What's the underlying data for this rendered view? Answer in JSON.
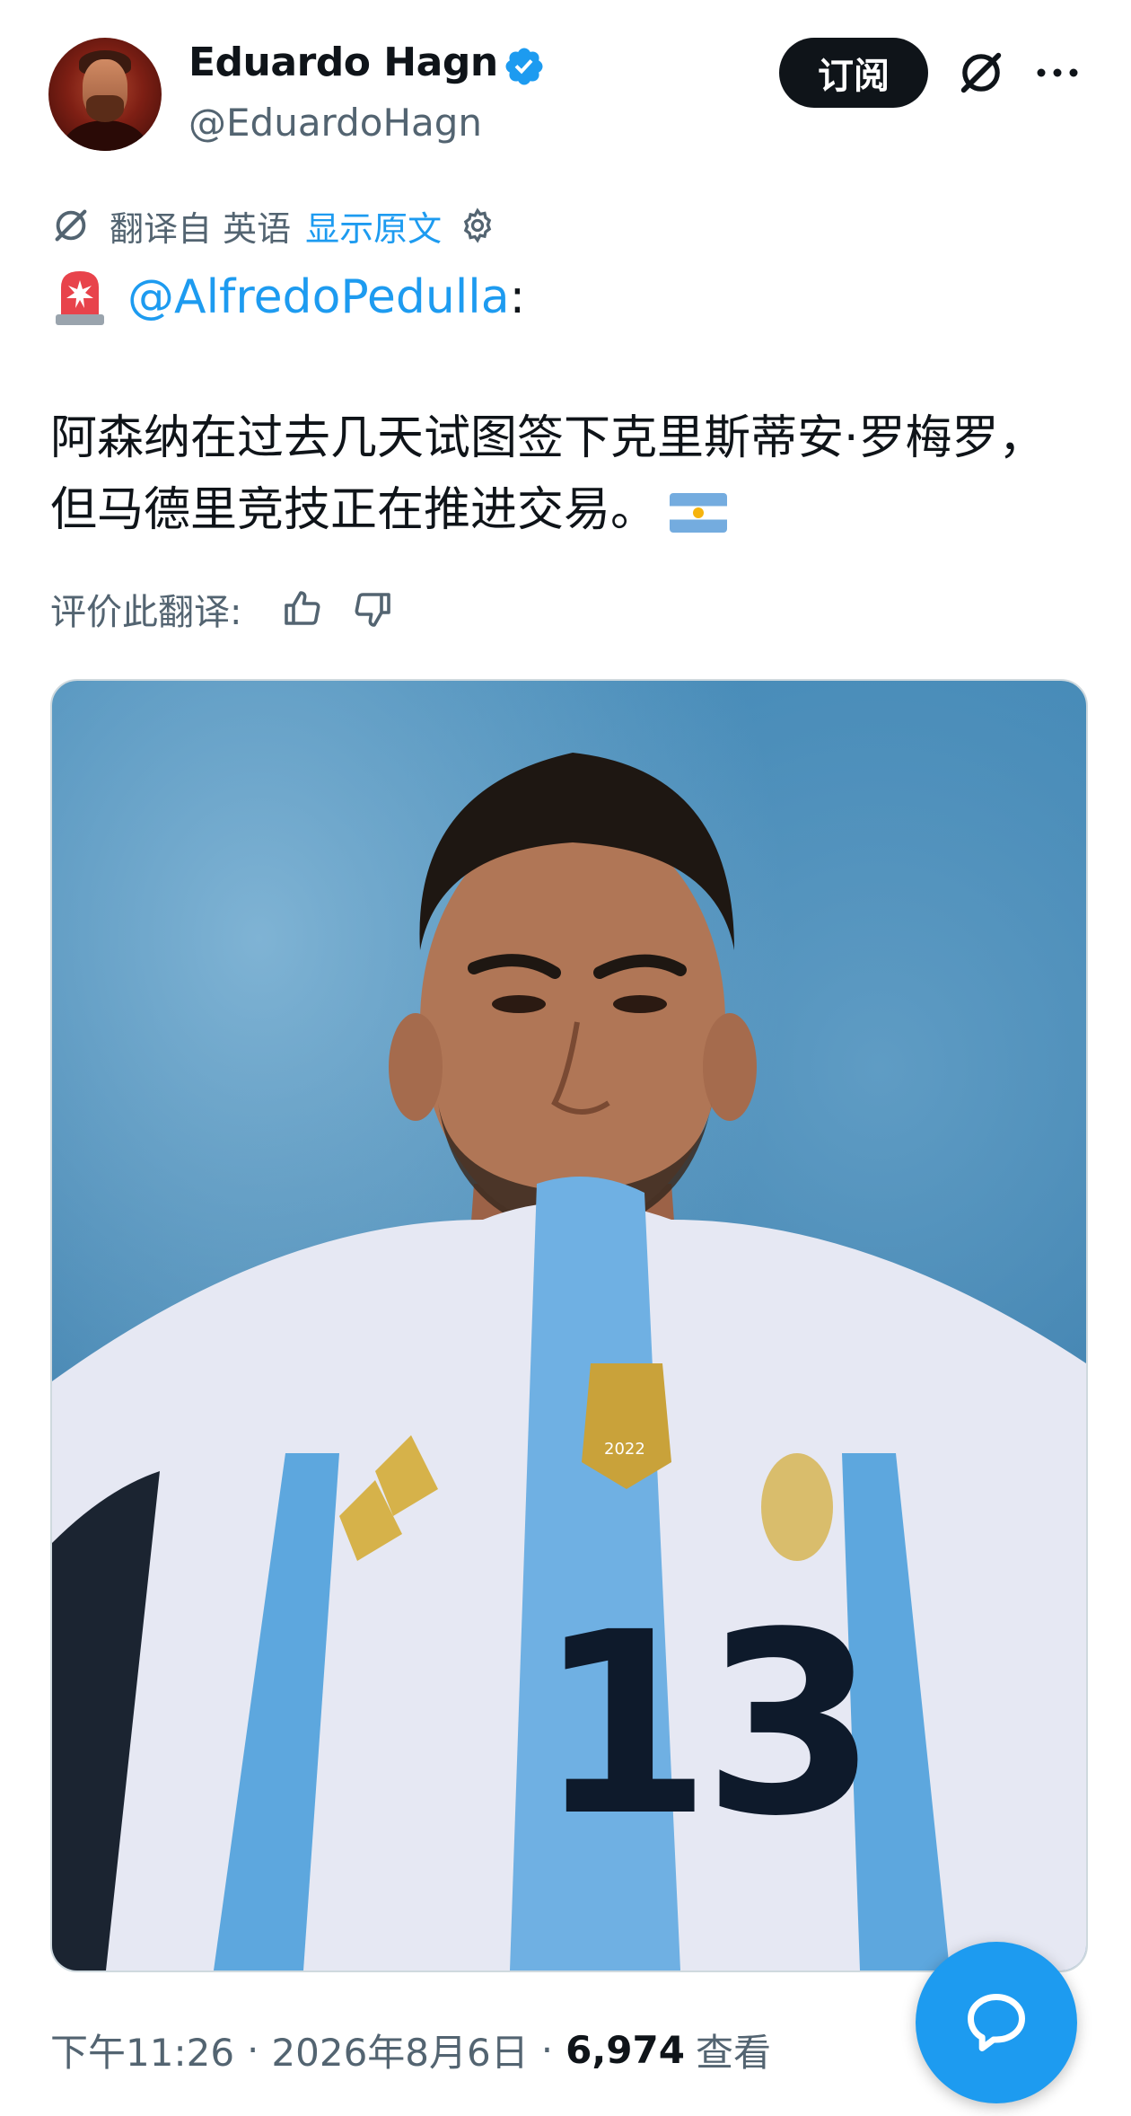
{
  "author": {
    "display_name": "Eduardo Hagn",
    "handle": "@EduardoHagn",
    "verified": true
  },
  "header": {
    "subscribe_label": "订阅",
    "grok_icon": "grok-icon",
    "more_icon": "more-dots-icon"
  },
  "translation": {
    "prefix": "翻译自 英语",
    "show_original": "显示原文",
    "rate_label": "评价此翻译:"
  },
  "tweet": {
    "siren_icon": "siren-emoji-icon",
    "mention": "@AlfredoPedulla",
    "mention_suffix": ":",
    "line1": "阿森纳在过去几天试图签下克里斯蒂安·罗梅罗，",
    "line2": "但马德里竞技正在推进交易。",
    "flag_icon": "argentina-flag-emoji"
  },
  "media": {
    "jersey_number": "13",
    "badge_year": "2022"
  },
  "meta": {
    "time": "下午11:26",
    "separator": "·",
    "date": "2026年8月6日",
    "views_count": "6,974",
    "views_label": "查看"
  },
  "colors": {
    "accent": "#1d9bf0",
    "text": "#0f1419",
    "muted": "#536471"
  }
}
